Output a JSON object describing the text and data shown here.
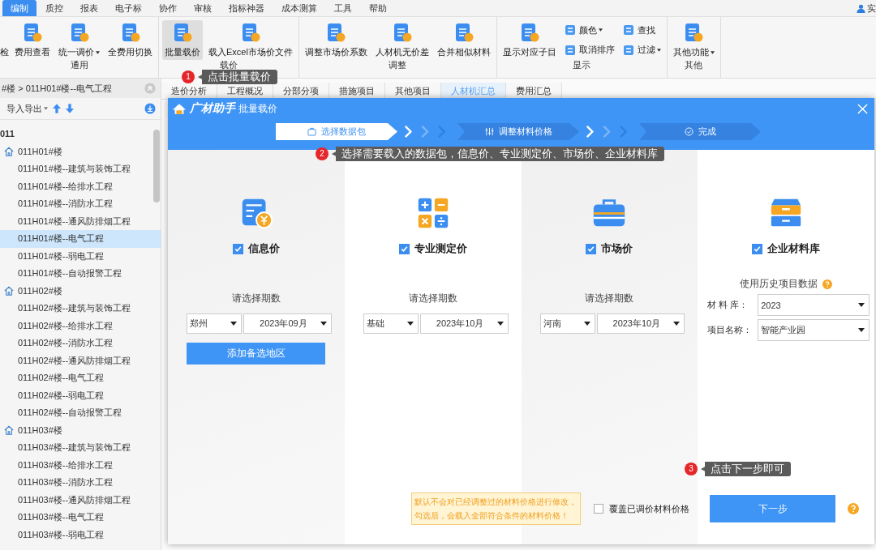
{
  "menu_tabs": [
    {
      "label": "编制",
      "selected": true
    },
    {
      "label": "质控",
      "selected": false
    },
    {
      "label": "报表",
      "selected": false
    },
    {
      "label": "电子标",
      "selected": false
    },
    {
      "label": "协作",
      "selected": false
    },
    {
      "label": "审核",
      "selected": false
    },
    {
      "label": "指标神器",
      "selected": false
    },
    {
      "label": "成本测算",
      "selected": false
    },
    {
      "label": "工具",
      "selected": false
    },
    {
      "label": "帮助",
      "selected": false
    }
  ],
  "user": "实",
  "ribbon": {
    "groups": [
      {
        "label": "通用",
        "buttons": [
          {
            "label": "检",
            "kind": "clipped",
            "selected": false
          },
          {
            "label": "费用查看",
            "kind": "large",
            "dropdown": false,
            "selected": false
          },
          {
            "label": "统一调价",
            "kind": "large",
            "dropdown": true,
            "selected": false
          },
          {
            "label": "全费用切换",
            "kind": "large",
            "dropdown": false,
            "selected": false
          }
        ]
      },
      {
        "label": "载价",
        "buttons": [
          {
            "label": "批量载价",
            "kind": "large",
            "dropdown": false,
            "selected": true
          },
          {
            "label": "载入Excel市场价文件",
            "kind": "large",
            "dropdown": false,
            "selected": false
          }
        ]
      },
      {
        "label": "调整",
        "buttons": [
          {
            "label": "调整市场价系数",
            "kind": "large",
            "dropdown": false,
            "selected": false
          },
          {
            "label": "人材机无价差",
            "kind": "large",
            "dropdown": false,
            "selected": false
          },
          {
            "label": "合并相似材料",
            "kind": "large",
            "dropdown": false,
            "selected": false
          }
        ]
      },
      {
        "label": "显示",
        "buttons": [
          {
            "label": "显示对应子目",
            "kind": "large",
            "dropdown": false,
            "selected": false
          },
          {
            "label": "颜色",
            "kind": "small",
            "dropdown": true,
            "selected": false
          },
          {
            "label": "取消排序",
            "kind": "small",
            "dropdown": false,
            "selected": false
          },
          {
            "label": "查找",
            "kind": "small",
            "dropdown": false,
            "selected": false
          },
          {
            "label": "过滤",
            "kind": "small",
            "dropdown": true,
            "selected": false
          }
        ]
      },
      {
        "label": "其他",
        "buttons": [
          {
            "label": "其他功能",
            "kind": "large",
            "dropdown": true,
            "selected": false
          }
        ]
      }
    ]
  },
  "sidebar": {
    "breadcrumb": "#楼 > 011H01#楼--电气工程",
    "toolbar_label": "导入导出",
    "tree": {
      "label": "011",
      "selected": false,
      "children": [
        {
          "label": "011H01#楼",
          "selected": false,
          "children": [
            {
              "label": "011H01#楼--建筑与装饰工程",
              "selected": false
            },
            {
              "label": "011H01#楼--给排水工程",
              "selected": false
            },
            {
              "label": "011H01#楼--消防水工程",
              "selected": false
            },
            {
              "label": "011H01#楼--通风防排烟工程",
              "selected": false
            },
            {
              "label": "011H01#楼--电气工程",
              "selected": true
            },
            {
              "label": "011H01#楼--弱电工程",
              "selected": false
            },
            {
              "label": "011H01#楼--自动报警工程",
              "selected": false
            }
          ]
        },
        {
          "label": "011H02#楼",
          "selected": false,
          "children": [
            {
              "label": "011H02#楼--建筑与装饰工程",
              "selected": false
            },
            {
              "label": "011H02#楼--给排水工程",
              "selected": false
            },
            {
              "label": "011H02#楼--消防水工程",
              "selected": false
            },
            {
              "label": "011H02#楼--通风防排烟工程",
              "selected": false
            },
            {
              "label": "011H02#楼--电气工程",
              "selected": false
            },
            {
              "label": "011H02#楼--弱电工程",
              "selected": false
            },
            {
              "label": "011H02#楼--自动报警工程",
              "selected": false
            }
          ]
        },
        {
          "label": "011H03#楼",
          "selected": false,
          "children": [
            {
              "label": "011H03#楼--建筑与装饰工程",
              "selected": false
            },
            {
              "label": "011H03#楼--给排水工程",
              "selected": false
            },
            {
              "label": "011H03#楼--消防水工程",
              "selected": false
            },
            {
              "label": "011H03#楼--通风防排烟工程",
              "selected": false
            },
            {
              "label": "011H03#楼--电气工程",
              "selected": false
            },
            {
              "label": "011H03#楼--弱电工程",
              "selected": false
            }
          ]
        }
      ]
    }
  },
  "content_tabs": [
    {
      "label": "造价分析",
      "selected": false
    },
    {
      "label": "工程概况",
      "selected": false
    },
    {
      "label": "分部分项",
      "selected": false
    },
    {
      "label": "措施项目",
      "selected": false
    },
    {
      "label": "其他项目",
      "selected": false
    },
    {
      "label": "人材机汇总",
      "selected": true
    },
    {
      "label": "费用汇总",
      "selected": false
    }
  ],
  "dialog": {
    "logo": "广材助手",
    "title": "批量载价",
    "steps": [
      {
        "label": "选择数据包",
        "selected": true
      },
      {
        "label": "调整材料价格",
        "selected": false
      },
      {
        "label": "完成",
        "selected": false
      }
    ],
    "sources": [
      {
        "kind": "period",
        "title": "信息价",
        "checked": true,
        "period_label": "请选择期数",
        "region": "郑州",
        "period": "2023年09月",
        "action": "添加备选地区"
      },
      {
        "kind": "period",
        "title": "专业测定价",
        "checked": true,
        "period_label": "请选择期数",
        "region": "基础",
        "period": "2023年10月"
      },
      {
        "kind": "period",
        "title": "市场价",
        "checked": true,
        "period_label": "请选择期数",
        "region": "河南",
        "period": "2023年10月"
      },
      {
        "kind": "library",
        "title": "企业材料库",
        "checked": true,
        "subtitle": "使用历史项目数据",
        "fields": [
          {
            "label": "材 料 库：",
            "value": "2023"
          },
          {
            "label": "项目名称：",
            "value": "智能产业园"
          }
        ]
      }
    ],
    "note": "默认不会对已经调整过的材料价格进行修改，勾选后，会载入全部符合条件的材料价格！",
    "overwrite": {
      "label": "覆盖已调价材料价格",
      "checked": false
    },
    "next_button": "下一步"
  },
  "callouts": [
    {
      "number": "1",
      "text": "点击批量载价"
    },
    {
      "number": "2",
      "text": "选择需要载入的数据包，信息价、专业测定价、市场价、企业材料库"
    },
    {
      "number": "3",
      "text": "点击下一步即可"
    }
  ]
}
